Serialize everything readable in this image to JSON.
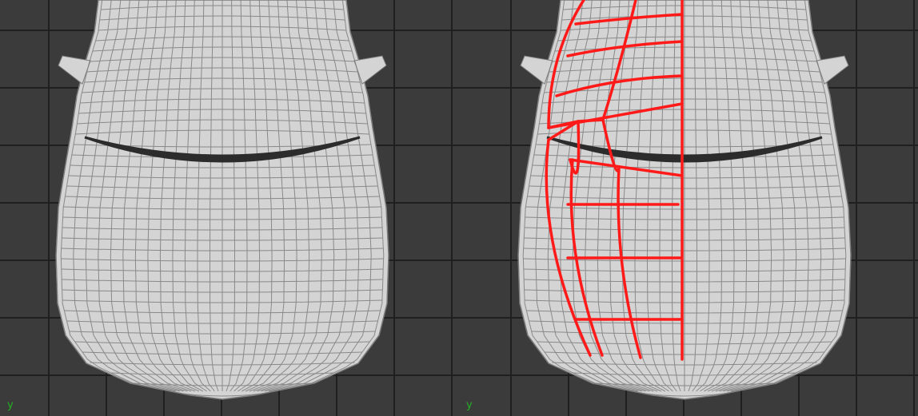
{
  "viewports": [
    {
      "axis_label": "y",
      "highlight": false
    },
    {
      "axis_label": "y",
      "highlight": true
    }
  ],
  "colors": {
    "background": "#3b3b3b",
    "grid": "#1f1f1f",
    "body_fill": "#d4d4d4",
    "wire": "#7c7c7c",
    "highlight": "#ff1a1a",
    "axis_label": "#22b322"
  },
  "icons": {
    "axis_indicator": "y-axis-label"
  }
}
